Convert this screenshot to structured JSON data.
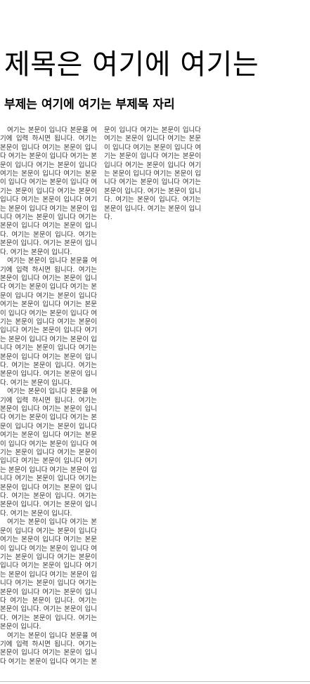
{
  "document": {
    "title": "제목은 여기에 여기는",
    "subtitle": "부제는 여기에 여기는 부제목 자리",
    "paragraphs": [
      "여기는 본문이 입니다 본문을 여기에 입력 하시면 됩니다. 여기는 본문이 입니다 여기는 본문이 입니다 여기는 본문이 입니다 여기는 본문이 입니다 여기는 본문이 입니다 여기는 본문이 입니다 여기는 본문이 입니다 여기는 본문이 입니다 여기는 본문이 입니다 여기는 본문이 입니다 여기는 본문이 입니다 여기는 본문이 입니다 여기는 본문이 입니다 여기는 본문이 입니다 여기는 본문이 입니다 여기는 본문이 입니다. 여기는 본문이 입니다. 여기는 본문이 입니다. 여기는 본문이 입니다. 여기는 본문이 입니다.",
      "여기는 본문이 입니다 본문을 여기에 입력 하시면 됩니다. 여기는 본문이 입니다 여기는 본문이 입니다 여기는 본문이 입니다 여기는 본문이 입니다 여기는 본문이 입니다 여기는 본문이 입니다 여기는 본문이 입니다 여기는 본문이 입니다 여기는 본문이 입니다 여기는 본문이 입니다 여기는 본문이 입니다 여기는 본문이 입니다 여기는 본문이 입니다 여기는 본문이 입니다 여기는 본문이 입니다 여기는 본문이 입니다. 여기는 본문이 입니다. 여기는 본문이 입니다. 여기는 본문이 입니다. 여기는 본문이 입니다.",
      "여기는 본문이 입니다 본문을 여기에 입력 하시면 됩니다. 여기는 본문이 입니다 여기는 본문이 입니다 여기는 본문이 입니다 여기는 본문이 입니다 여기는 본문이 입니다 여기는 본문이 입니다 여기는 본문이 입니다 여기는 본문이 입니다 여기는 본문이 입니다 여기는 본문이 입니다 여기는 본문이 입니다 여기는 본문이 입니다 여기는 본문이 입니다 여기는 본문이 입니다 여기는 본문이 입니다 여기는 본문이 입니다. 여기는 본문이 입니다. 여기는 본문이 입니다. 여기는 본문이 입니다. 여기는 본문이 입니다.",
      "여기는 본문이 입니다 여기는 본문이 입니다 여기는 본문이 입니다 여기는 본문이 입니다 여기는 본문이 입니다 여기는 본문이 입니다 여기는 본문이 입니다 여기는 본문이 입니다 여기는 본문이 입니다 여기는 본문이 입니다 여기는 본문이 입니다 여기는 본문이 입니다 여기는 본문이 입니다 여기는 본문이 입니다 여기는 본문이 입니다. 여기는 본문이 입니다. 여기는 본문이 입니다. 여기는 본문이 입니다. 여기는 본문이 입니다.",
      "여기는 본문이 입니다 본문을 여기에 입력 하시면 됩니다. 여기는 본문이 입니다 여기는 본문이 입니다 여기는 본문이 입니다 여기는 본문이 입니다 여기는 본문이 입니다 여기는 본문이 입니다 여기는 본문이 입니다 여기는 본문이 입니다 여기는 본문이 입니다 여기는 본문이 입니다 여기는 본문이 입니다 여기는 본문이 입니다 여기는 본문이 입니다 여기는 본문이 입니다 여기는 본문이 입니다. 여기는 본문이 입니다. 여기는 본문이 입니다. 여기는 본문이 입니다. 여기는 본문이 입니다."
    ]
  }
}
